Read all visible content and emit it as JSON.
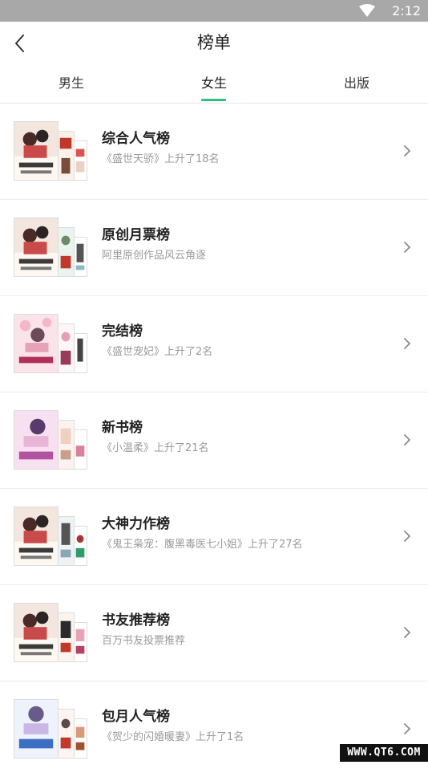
{
  "status_bar": {
    "time": "2:12",
    "wifi_icon": "wifi-icon"
  },
  "header": {
    "title": "榜单",
    "back_icon": "chevron-left-icon"
  },
  "tabs": [
    {
      "label": "男生",
      "active": false
    },
    {
      "label": "女生",
      "active": true
    },
    {
      "label": "出版",
      "active": false
    }
  ],
  "accent_color": "#2fc27f",
  "rankings": [
    {
      "title": "综合人气榜",
      "subtitle": "《盛世天骄》上升了18名"
    },
    {
      "title": "原创月票榜",
      "subtitle": "阿里原创作品风云角逐"
    },
    {
      "title": "完结榜",
      "subtitle": "《盛世宠妃》上升了2名"
    },
    {
      "title": "新书榜",
      "subtitle": "《小温柔》上升了21名"
    },
    {
      "title": "大神力作榜",
      "subtitle": "《鬼王枭宠：腹黑毒医七小姐》上升了27名"
    },
    {
      "title": "书友推荐榜",
      "subtitle": "百万书友投票推荐"
    },
    {
      "title": "包月人气榜",
      "subtitle": "《贺少的闪婚暖妻》上升了1名"
    }
  ],
  "watermark": "WWW.QT6.COM"
}
